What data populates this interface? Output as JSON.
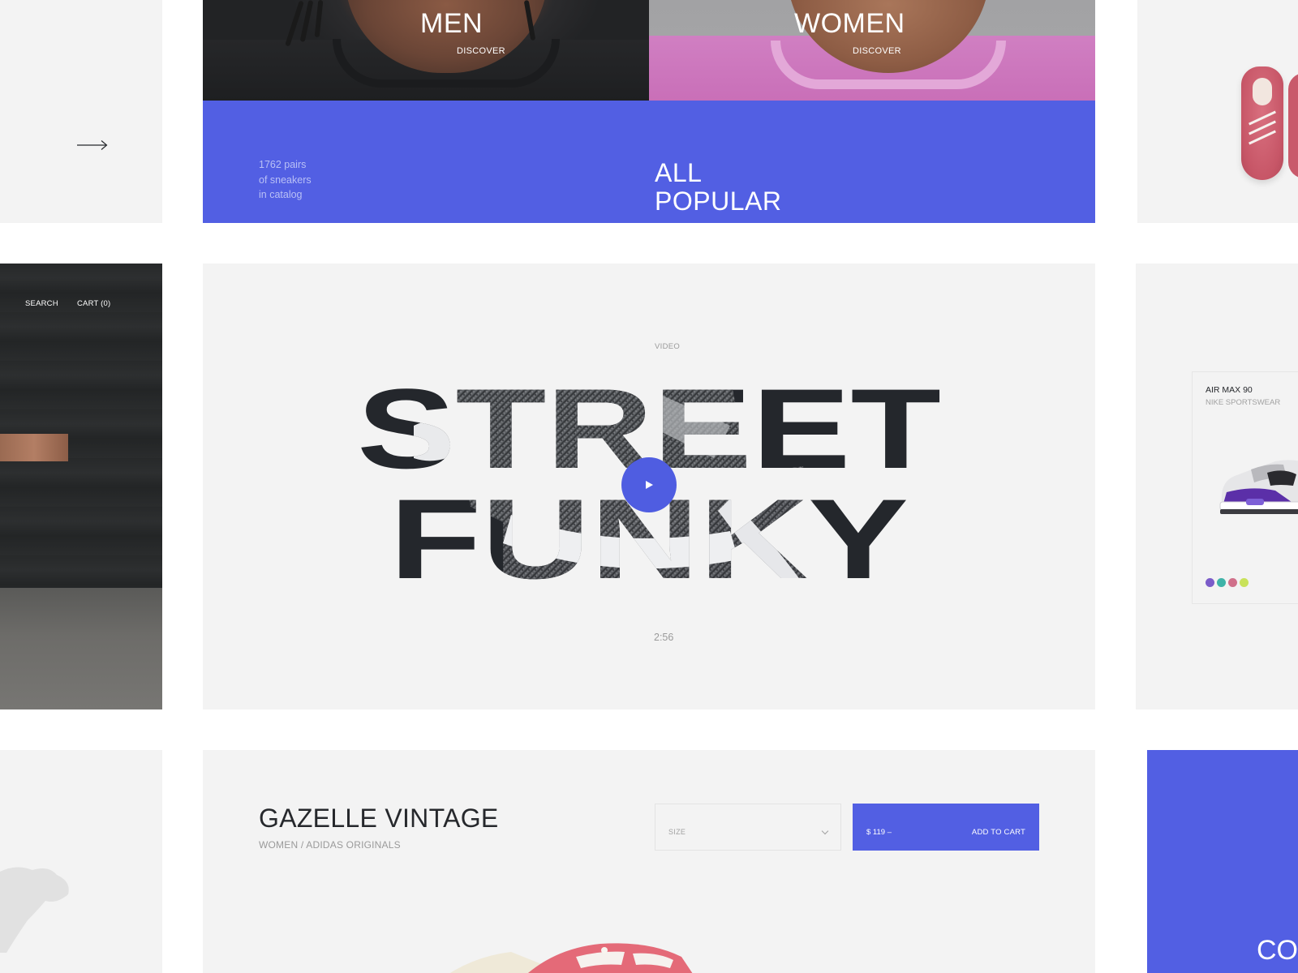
{
  "categories": {
    "men": {
      "title": "MEN",
      "cta": "DISCOVER"
    },
    "women": {
      "title": "WOMEN",
      "cta": "DISCOVER"
    }
  },
  "popular_band": {
    "catalog_line1": "1762 pairs",
    "catalog_line2": "of sneakers",
    "catalog_line3": "in catalog",
    "title_line1": "ALL",
    "title_line2": "POPULAR"
  },
  "nav": {
    "search": "SEARCH",
    "cart": "CART (0)"
  },
  "video": {
    "label": "VIDEO",
    "line1": "STREET",
    "line2": "FUNKY",
    "duration": "2:56"
  },
  "side_product": {
    "name": "AIR MAX 90",
    "brand": "NIKE SPORTSWEAR",
    "swatch_colors": [
      "#7b5cc9",
      "#3fb3a8",
      "#d0708a",
      "#c9e25a"
    ]
  },
  "product": {
    "title": "GAZELLE VINTAGE",
    "subtitle": "WOMEN / ADIDAS ORIGINALS",
    "size_label": "SIZE",
    "price": "$ 119 –",
    "add_to_cart": "ADD TO CART"
  },
  "right_bottom_text": "CO",
  "colors": {
    "accent": "#525fe3",
    "panel": "#f3f3f3",
    "text_dark": "#26282c",
    "text_muted": "#9a9a9a"
  }
}
